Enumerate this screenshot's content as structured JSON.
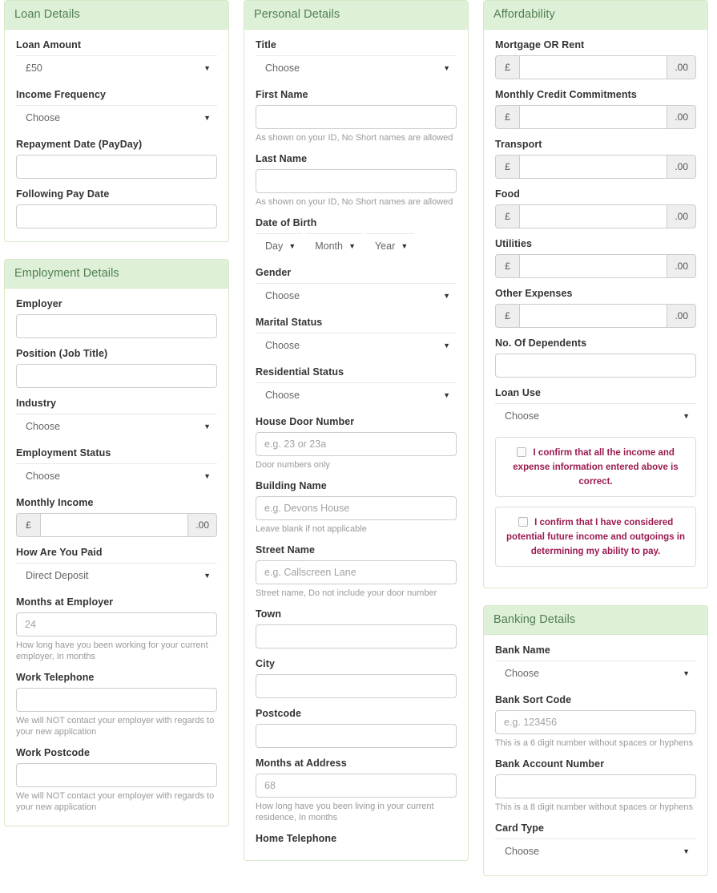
{
  "panels": {
    "loan": {
      "title": "Loan Details",
      "loan_amount_label": "Loan Amount",
      "loan_amount_value": "£50",
      "income_frequency_label": "Income Frequency",
      "income_frequency_value": "Choose",
      "repayment_date_label": "Repayment Date (PayDay)",
      "repayment_date_value": "",
      "following_pay_date_label": "Following Pay Date",
      "following_pay_date_value": ""
    },
    "employment": {
      "title": "Employment Details",
      "employer_label": "Employer",
      "employer_value": "",
      "position_label": "Position (Job Title)",
      "position_value": "",
      "industry_label": "Industry",
      "industry_value": "Choose",
      "employment_status_label": "Employment Status",
      "employment_status_value": "Choose",
      "monthly_income_label": "Monthly Income",
      "monthly_income_value": "",
      "currency_symbol": "£",
      "decimal_suffix": ".00",
      "how_paid_label": "How Are You Paid",
      "how_paid_value": "Direct Deposit",
      "months_at_employer_label": "Months at Employer",
      "months_at_employer_placeholder": "24",
      "months_at_employer_help": "How long have you been working for your current employer, In months",
      "work_telephone_label": "Work Telephone",
      "work_telephone_value": "",
      "work_telephone_help": "We will NOT contact your employer with regards to your new application",
      "work_postcode_label": "Work Postcode",
      "work_postcode_value": "",
      "work_postcode_help": "We will NOT contact your employer with regards to your new application"
    },
    "personal": {
      "title": "Personal Details",
      "title_field_label": "Title",
      "title_field_value": "Choose",
      "first_name_label": "First Name",
      "first_name_value": "",
      "first_name_help": "As shown on your ID, No Short names are allowed",
      "last_name_label": "Last Name",
      "last_name_value": "",
      "last_name_help": "As shown on your ID, No Short names are allowed",
      "dob_label": "Date of Birth",
      "dob_day": "Day",
      "dob_month": "Month",
      "dob_year": "Year",
      "gender_label": "Gender",
      "gender_value": "Choose",
      "marital_status_label": "Marital Status",
      "marital_status_value": "Choose",
      "residential_status_label": "Residential Status",
      "residential_status_value": "Choose",
      "house_door_number_label": "House Door Number",
      "house_door_number_placeholder": "e.g. 23 or 23a",
      "house_door_number_help": "Door numbers only",
      "building_name_label": "Building Name",
      "building_name_placeholder": "e.g. Devons House",
      "building_name_help": "Leave blank if not applicable",
      "street_name_label": "Street Name",
      "street_name_placeholder": "e.g. Callscreen Lane",
      "street_name_help": "Street name, Do not include your door number",
      "town_label": "Town",
      "town_value": "",
      "city_label": "City",
      "city_value": "",
      "postcode_label": "Postcode",
      "postcode_value": "",
      "months_at_address_label": "Months at Address",
      "months_at_address_placeholder": "68",
      "months_at_address_help": "How long have you been living in your current residence, In months",
      "home_telephone_label": "Home Telephone"
    },
    "affordability": {
      "title": "Affordability",
      "currency_symbol": "£",
      "decimal_suffix": ".00",
      "mortgage_label": "Mortgage OR Rent",
      "mortgage_value": "",
      "credit_commitments_label": "Monthly Credit Commitments",
      "credit_commitments_value": "",
      "transport_label": "Transport",
      "transport_value": "",
      "food_label": "Food",
      "food_value": "",
      "utilities_label": "Utilities",
      "utilities_value": "",
      "other_expenses_label": "Other Expenses",
      "other_expenses_value": "",
      "dependents_label": "No. Of Dependents",
      "dependents_value": "",
      "loan_use_label": "Loan Use",
      "loan_use_value": "Choose",
      "confirm_income_text": "I confirm that all the income and expense information entered above is correct.",
      "confirm_future_text": "I confirm that I have considered potential future income and outgoings in determining my ability to pay.",
      "confirm_text_color": "#9b1b51"
    },
    "banking": {
      "title": "Banking Details",
      "bank_name_label": "Bank Name",
      "bank_name_value": "Choose",
      "sort_code_label": "Bank Sort Code",
      "sort_code_placeholder": "e.g. 123456",
      "sort_code_help": "This is a 6 digit number without spaces or hyphens",
      "account_number_label": "Bank Account Number",
      "account_number_value": "",
      "account_number_help": "This is a 8 digit number without spaces or hyphens",
      "card_type_label": "Card Type",
      "card_type_value": "Choose"
    }
  },
  "icons": {
    "caret": "▼"
  },
  "theme": {
    "panel_header_bg": "#dff0d8",
    "panel_border": "#d6e9c6",
    "header_text": "#4f7f52"
  }
}
